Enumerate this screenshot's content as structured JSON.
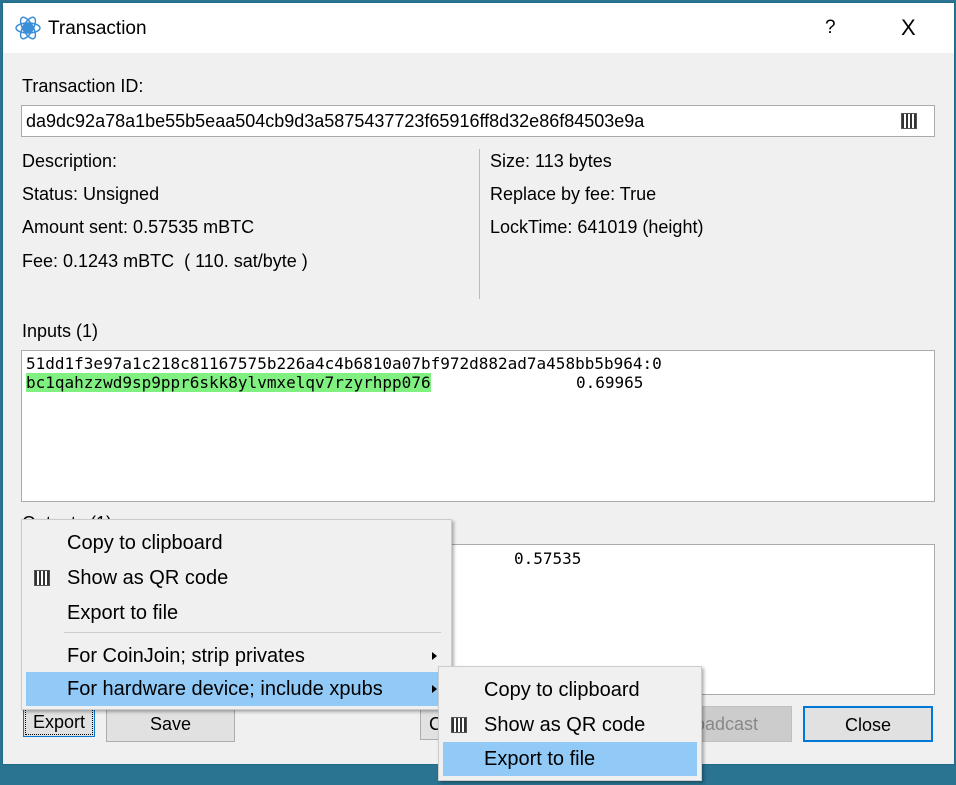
{
  "window": {
    "title": "Transaction",
    "help": "?",
    "close": "X"
  },
  "txid": {
    "label": "Transaction ID:",
    "value": "da9dc92a78a1be55b5eaa504cb9d3a5875437723f65916ff8d32e86f84503e9a"
  },
  "info_left": [
    "Description:",
    "Status: Unsigned",
    "Amount sent: 0.57535 mBTC",
    "Fee: 0.1243 mBTC  ( 110. sat/byte )"
  ],
  "info_right": [
    "Size: 113 bytes",
    "Replace by fee: True",
    "LockTime: 641019 (height)"
  ],
  "inputs": {
    "label": "Inputs (1)",
    "prevout": "51dd1f3e97a1c218c81167575b226a4c4b6810a07bf972d882ad7a458bb5b964:0",
    "address": "bc1qahzzwd9sp9ppr6skk8ylvmxelqv7rzyrhpp076",
    "amount": "0.69965",
    "address_highlight": "#80f080"
  },
  "outputs": {
    "label": "Outputs (1)",
    "amount": "0.57535"
  },
  "buttons": {
    "export": "Export",
    "save": "Save",
    "combine": "Co",
    "broadcast": "Broadcast",
    "close": "Close"
  },
  "export_menu": {
    "items": [
      "Copy to clipboard",
      "Show as QR code",
      "Export to file",
      "For CoinJoin; strip privates",
      "For hardware device; include xpubs"
    ]
  },
  "submenu": {
    "items": [
      "Copy to clipboard",
      "Show as QR code",
      "Export to file"
    ]
  },
  "colors": {
    "highlight": "#91c9f7",
    "accent": "#0078d7"
  }
}
